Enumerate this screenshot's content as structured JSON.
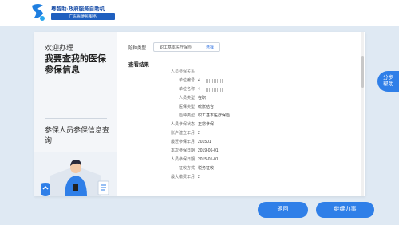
{
  "header": {
    "brand_title": "粤智助·政府服务自助机",
    "brand_sub": "广东省便民服务"
  },
  "left": {
    "welcome": "欢迎办理",
    "headline": "我要查我的医保参保信息",
    "subtitle": "参保人员参保信息查询"
  },
  "form": {
    "type_label": "险种类型",
    "type_value": "职工基本医疗保险",
    "type_link": "选择"
  },
  "results": {
    "title": "查看结果",
    "rows": [
      {
        "label": "人员参保关系",
        "value": "",
        "section": true
      },
      {
        "label": "单位编号",
        "value": "4"
      },
      {
        "label": "单位名称",
        "value": "4"
      },
      {
        "label": "人员类型",
        "value": "在职"
      },
      {
        "label": "医保类型",
        "value": "统账结合"
      },
      {
        "label": "险种类型",
        "value": "职工基本医疗保险"
      },
      {
        "label": "人员参保状态",
        "value": "正常参保"
      },
      {
        "label": "账户建立年月",
        "value": "2"
      },
      {
        "label": "最近参保年月",
        "value": "201501"
      },
      {
        "label": "本次参保日期",
        "value": "2019-06-01"
      },
      {
        "label": "人员参保日期",
        "value": "2015-01-01"
      },
      {
        "label": "征收方式",
        "value": "税务征收"
      },
      {
        "label": "最大缴费年月",
        "value": "2"
      }
    ]
  },
  "help_button": "分步\n帮助",
  "buttons": {
    "back": "返回",
    "continue": "继续办事"
  },
  "colors": {
    "accent": "#2f7fe8",
    "brand": "#1b4fa8",
    "background": "#dfe9f3"
  }
}
